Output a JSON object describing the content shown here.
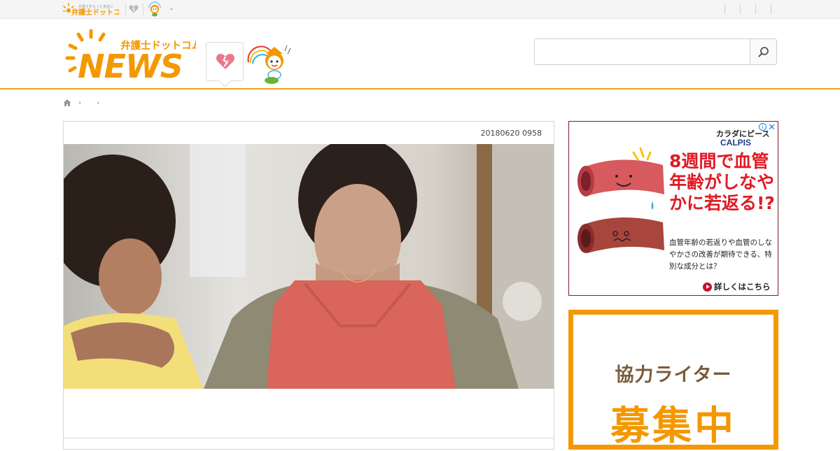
{
  "topbar": {
    "mini_logo_text": "弁護士ドットコム",
    "mini_logo_tagline": "弁護士をもっと身近に",
    "dash": "-"
  },
  "header": {
    "logo_jp": "弁護士ドットコム",
    "logo_en": "NEWS",
    "search": {
      "value": "",
      "placeholder": ""
    }
  },
  "breadcrumb": {
    "sep1": "›",
    "sep2": "›"
  },
  "article": {
    "date": "20180620 0958",
    "photo_alt": "台所で下を向くエプロン姿の女性と年配の女性"
  },
  "ad": {
    "brand_line1": "カラダにピース",
    "brand_line2": "CALPIS",
    "headline": "8週間で血管年齢がしなやかに若返る!?",
    "sub": "血管年齢の若返りや血管のしなやかさの改善が期待できる、特別な成分とは？",
    "cta": "詳しくはこちら",
    "info_glyph": "i",
    "close_glyph": "✕"
  },
  "recruit": {
    "line1": "協力ライター",
    "line2": "募集中"
  },
  "colors": {
    "accent": "#f0a31c",
    "recruit_orange": "#f39800",
    "ad_red": "#e11a25"
  },
  "icons": [
    "broken-heart-icon",
    "mascot-icon",
    "search-icon",
    "home-icon",
    "play-icon",
    "info-icon",
    "close-icon"
  ]
}
